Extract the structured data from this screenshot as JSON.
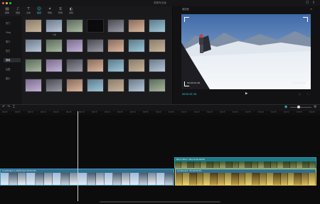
{
  "app": {
    "title": "剪映专业版"
  },
  "colors": {
    "accent": "#38c9dc",
    "clip_blue": "#2f6f91",
    "clip_teal": "#1e7a86",
    "clip_gold": "#c7a53a"
  },
  "toolbar": {
    "tools": [
      {
        "icon": "media-icon",
        "glyph": "▤",
        "label": "媒体"
      },
      {
        "icon": "audio-icon",
        "glyph": "♪",
        "label": "音频"
      },
      {
        "icon": "text-icon",
        "glyph": "T",
        "label": "文本"
      },
      {
        "icon": "sticker-icon",
        "glyph": "☺",
        "label": "贴纸"
      },
      {
        "icon": "effects-icon",
        "glyph": "✦",
        "label": "特效"
      },
      {
        "icon": "transition-icon",
        "glyph": "⧖",
        "label": "转场"
      },
      {
        "icon": "filter-icon",
        "glyph": "◐",
        "label": "滤镜"
      }
    ],
    "active_index": 3
  },
  "sidebar": {
    "items": [
      "热门",
      "Vlog",
      "旅行",
      "复古",
      "基础",
      "氛围",
      "胶片"
    ],
    "active_index": 4
  },
  "library": {
    "labels": [
      [
        "",
        "人像",
        "",
        "",
        "",
        "",
        ""
      ],
      [
        "",
        "",
        "",
        "",
        "",
        "",
        ""
      ],
      [
        "",
        "",
        "",
        "",
        "",
        "",
        ""
      ],
      [
        "",
        "",
        "",
        "",
        "",
        "",
        ""
      ]
    ]
  },
  "preview": {
    "title": "播放器",
    "time_left": "00:00:01:26",
    "time_right": "00:00:16:26"
  },
  "ruler": {
    "ticks": [
      "00:00",
      "00:05",
      "00:10",
      "00:15",
      "00:20",
      "00:25",
      "00:30",
      "00:35",
      "00:40",
      "00:45",
      "00:50",
      "00:55",
      "01:00",
      "01:05",
      "01:10",
      "01:15",
      "01:20",
      "01:25",
      "01:30",
      "01:35",
      "01:40",
      "01:45",
      "01:50",
      "01:55",
      "02:00"
    ]
  },
  "tracks": {
    "upper_clip_label": "Paris Hilton: 20170 00:00:00",
    "main_clip_label": "snowboard in 1000.mp4 00:02:00",
    "gold_clip_label": "snowboard: 30 00:00:20"
  }
}
